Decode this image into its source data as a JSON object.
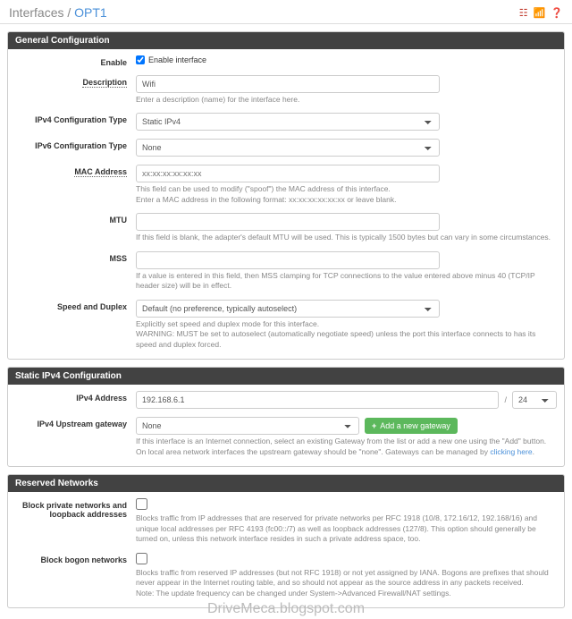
{
  "breadcrumb": {
    "root": "Interfaces",
    "sep": "/",
    "current": "OPT1"
  },
  "panels": {
    "general": {
      "title": "General Configuration",
      "enable": {
        "label": "Enable",
        "checkbox_label": "Enable interface"
      },
      "description": {
        "label": "Description",
        "value": "Wifi",
        "help": "Enter a description (name) for the interface here."
      },
      "ipv4type": {
        "label": "IPv4 Configuration Type",
        "value": "Static IPv4"
      },
      "ipv6type": {
        "label": "IPv6 Configuration Type",
        "value": "None"
      },
      "mac": {
        "label": "MAC Address",
        "placeholder": "xx:xx:xx:xx:xx:xx",
        "help": "This field can be used to modify (\"spoof\") the MAC address of this interface.\nEnter a MAC address in the following format: xx:xx:xx:xx:xx:xx or leave blank."
      },
      "mtu": {
        "label": "MTU",
        "help": "If this field is blank, the adapter's default MTU will be used. This is typically 1500 bytes but can vary in some circumstances."
      },
      "mss": {
        "label": "MSS",
        "help": "If a value is entered in this field, then MSS clamping for TCP connections to the value entered above minus 40 (TCP/IP header size) will be in effect."
      },
      "speed": {
        "label": "Speed and Duplex",
        "value": "Default (no preference, typically autoselect)",
        "help": "Explicitly set speed and duplex mode for this interface.\nWARNING: MUST be set to autoselect (automatically negotiate speed) unless the port this interface connects to has its speed and duplex forced."
      }
    },
    "static": {
      "title": "Static IPv4 Configuration",
      "ip": {
        "label": "IPv4 Address",
        "value": "192.168.6.1",
        "cidr": "24"
      },
      "gw": {
        "label": "IPv4 Upstream gateway",
        "value": "None",
        "button": "Add a new gateway",
        "help_a": "If this interface is an Internet connection, select an existing Gateway from the list or add a new one using the \"Add\" button.",
        "help_b": "On local area network interfaces the upstream gateway should be \"none\". Gateways can be managed by ",
        "help_link": "clicking here"
      }
    },
    "reserved": {
      "title": "Reserved Networks",
      "private": {
        "label": "Block private networks and loopback addresses",
        "help": "Blocks traffic from IP addresses that are reserved for private networks per RFC 1918 (10/8, 172.16/12, 192.168/16) and unique local addresses per RFC 4193 (fc00::/7) as well as loopback addresses (127/8). This option should generally be turned on, unless this network interface resides in such a private address space, too."
      },
      "bogon": {
        "label": "Block bogon networks",
        "help": "Blocks traffic from reserved IP addresses (but not RFC 1918) or not yet assigned by IANA. Bogons are prefixes that should never appear in the Internet routing table, and so should not appear as the source address in any packets received.",
        "note": "Note: The update frequency can be changed under System->Advanced Firewall/NAT settings."
      }
    }
  },
  "watermark": "DriveMeca.blogspot.com"
}
